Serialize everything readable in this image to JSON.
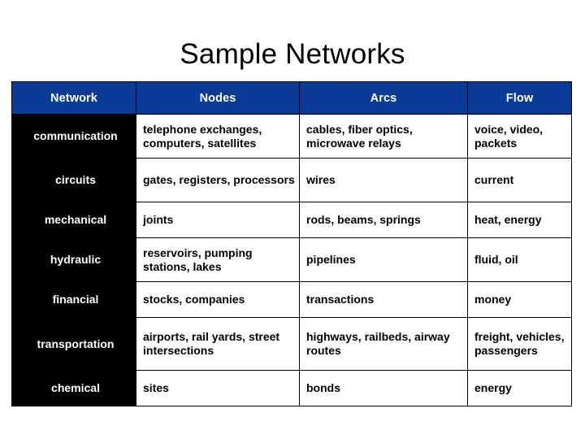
{
  "title": "Sample Networks",
  "table": {
    "columns": [
      {
        "key": "network",
        "label": "Network"
      },
      {
        "key": "nodes",
        "label": "Nodes"
      },
      {
        "key": "arcs",
        "label": "Arcs"
      },
      {
        "key": "flow",
        "label": "Flow"
      }
    ],
    "header_bg": "#0b3b99",
    "header_fg": "#ffffff",
    "category_bg": "#000000",
    "category_fg": "#ffffff",
    "cell_bg": "#ffffff",
    "cell_fg": "#000000",
    "border_color": "#000000",
    "rows": [
      {
        "network": "communication",
        "nodes": "telephone exchanges, computers, satellites",
        "arcs": "cables, fiber optics, microwave relays",
        "flow": "voice, video, packets"
      },
      {
        "network": "circuits",
        "nodes": "gates, registers, processors",
        "arcs": "wires",
        "flow": "current"
      },
      {
        "network": "mechanical",
        "nodes": "joints",
        "arcs": "rods, beams, springs",
        "flow": "heat, energy"
      },
      {
        "network": "hydraulic",
        "nodes": "reservoirs, pumping stations, lakes",
        "arcs": "pipelines",
        "flow": "fluid, oil"
      },
      {
        "network": "financial",
        "nodes": "stocks, companies",
        "arcs": "transactions",
        "flow": "money"
      },
      {
        "network": "transportation",
        "nodes": "airports, rail yards, street intersections",
        "arcs": "highways, railbeds, airway routes",
        "flow": "freight, vehicles, passengers"
      },
      {
        "network": "chemical",
        "nodes": "sites",
        "arcs": "bonds",
        "flow": "energy"
      }
    ]
  }
}
